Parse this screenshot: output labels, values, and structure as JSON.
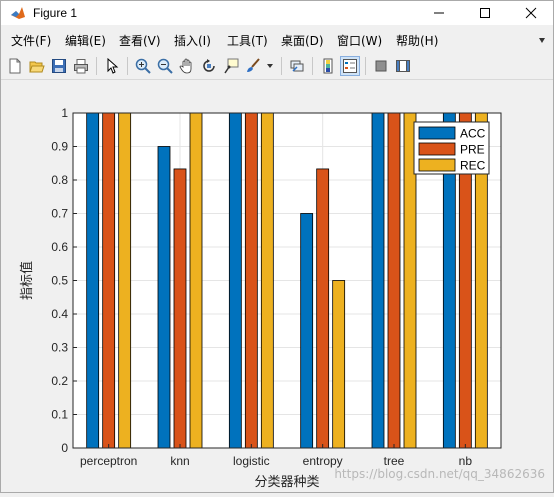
{
  "window": {
    "title": "Figure 1"
  },
  "menu": [
    {
      "label": "文件(F)"
    },
    {
      "label": "编辑(E)"
    },
    {
      "label": "查看(V)"
    },
    {
      "label": "插入(I)"
    },
    {
      "label": "工具(T)"
    },
    {
      "label": "桌面(D)"
    },
    {
      "label": "窗口(W)"
    },
    {
      "label": "帮助(H)"
    }
  ],
  "toolbar": {
    "icons": [
      "new-figure-icon",
      "open-file-icon",
      "save-icon",
      "print-icon",
      "pointer-icon",
      "zoom-in-icon",
      "zoom-out-icon",
      "pan-icon",
      "rotate-3d-icon",
      "data-cursor-icon",
      "brush-icon",
      "link-plot-icon",
      "colorbar-icon",
      "legend-icon",
      "hide-plot-tools-icon",
      "show-plot-tools-icon"
    ]
  },
  "colors": {
    "acc": "#0072bd",
    "pre": "#d95319",
    "rec": "#edb120"
  },
  "chart_data": {
    "type": "bar",
    "categories": [
      "perceptron",
      "knn",
      "logistic",
      "entropy",
      "tree",
      "nb"
    ],
    "series": [
      {
        "name": "ACC",
        "values": [
          1.0,
          0.9,
          1.0,
          0.7,
          1.0,
          1.0
        ]
      },
      {
        "name": "PRE",
        "values": [
          1.0,
          0.833,
          1.0,
          0.833,
          1.0,
          1.0
        ]
      },
      {
        "name": "REC",
        "values": [
          1.0,
          1.0,
          1.0,
          0.5,
          1.0,
          1.0
        ]
      }
    ],
    "yticks": [
      "0",
      "0.1",
      "0.2",
      "0.3",
      "0.4",
      "0.5",
      "0.6",
      "0.7",
      "0.8",
      "0.9",
      "1"
    ],
    "ylim": [
      0,
      1
    ],
    "xlabel": "分类器种类",
    "ylabel": "指标值",
    "legend_position": "top-right",
    "grid": true
  },
  "watermark": "https://blog.csdn.net/qq_34862636"
}
